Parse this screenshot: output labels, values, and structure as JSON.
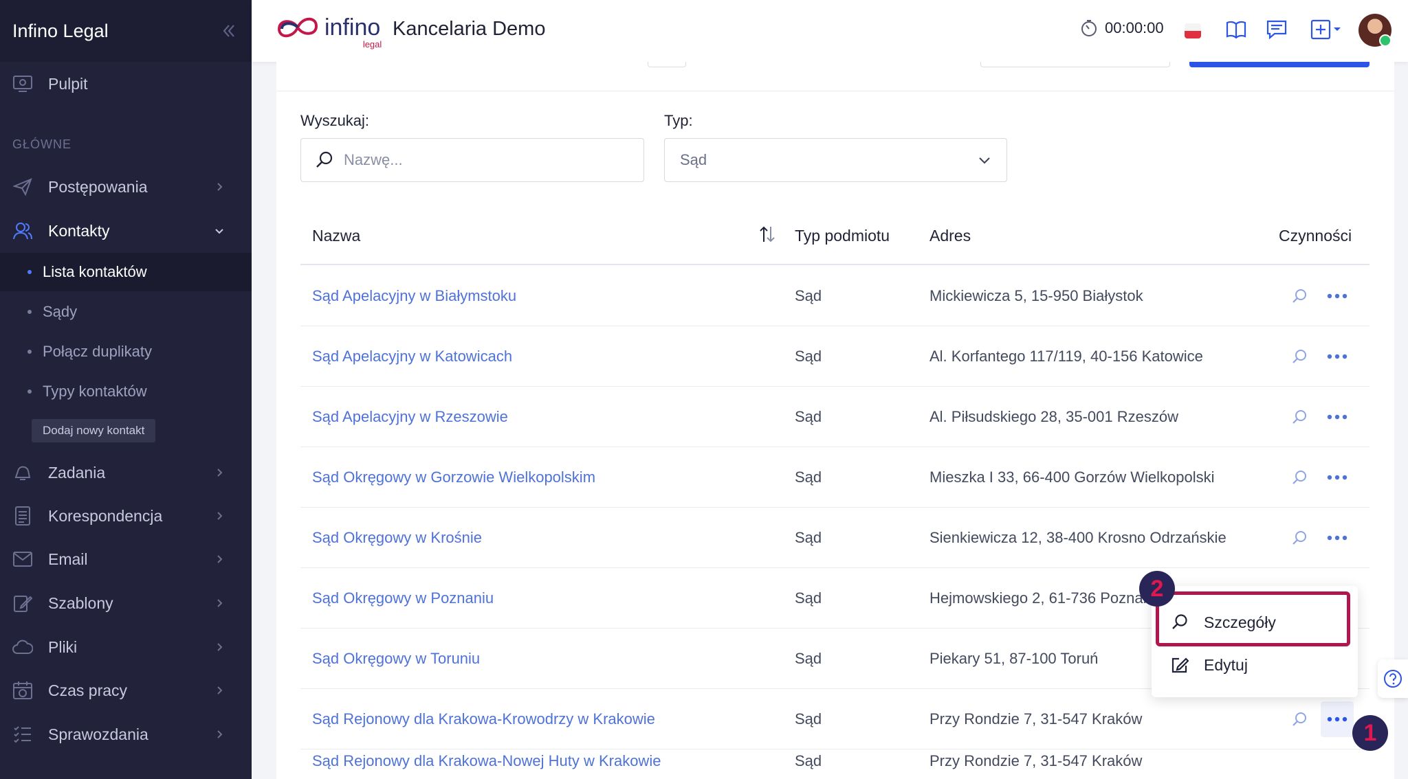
{
  "sidebar": {
    "title": "Infino Legal",
    "dashboard": "Pulpit",
    "section_label": "GŁÓWNE",
    "items": {
      "proceedings": "Postępowania",
      "contacts": "Kontakty",
      "tasks": "Zadania",
      "correspondence": "Korespondencja",
      "email": "Email",
      "templates": "Szablony",
      "files": "Pliki",
      "work_time": "Czas pracy",
      "reports": "Sprawozdania"
    },
    "contacts_sub": {
      "list": "Lista kontaktów",
      "courts": "Sądy",
      "merge": "Połącz duplikaty",
      "types": "Typy kontaktów",
      "add_new": "Dodaj nowy kontakt"
    }
  },
  "header": {
    "logo_word": "infino",
    "logo_sub": "legal",
    "firm_name": "Kancelaria Demo",
    "timer": "00:00:00"
  },
  "filters": {
    "search_label": "Wyszukaj:",
    "search_placeholder": "Nazwę...",
    "type_label": "Typ:",
    "type_value": "Sąd"
  },
  "table": {
    "columns": {
      "name": "Nazwa",
      "entity_type": "Typ podmiotu",
      "address": "Adres",
      "actions": "Czynności"
    },
    "rows": [
      {
        "name": "Sąd Apelacyjny w Białymstoku",
        "type": "Sąd",
        "address": "Mickiewicza 5, 15-950 Białystok"
      },
      {
        "name": "Sąd Apelacyjny w Katowicach",
        "type": "Sąd",
        "address": "Al. Korfantego 117/119, 40-156 Katowice"
      },
      {
        "name": "Sąd Apelacyjny w Rzeszowie",
        "type": "Sąd",
        "address": "Al. Piłsudskiego 28, 35-001 Rzeszów"
      },
      {
        "name": "Sąd Okręgowy w Gorzowie Wielkopolskim",
        "type": "Sąd",
        "address": "Mieszka I 33, 66-400 Gorzów Wielkopolski"
      },
      {
        "name": "Sąd Okręgowy w Krośnie",
        "type": "Sąd",
        "address": "Sienkiewicza 12, 38-400 Krosno Odrzańskie"
      },
      {
        "name": "Sąd Okręgowy w Poznaniu",
        "type": "Sąd",
        "address": "Hejmowskiego 2, 61-736 Poznań"
      },
      {
        "name": "Sąd Okręgowy w Toruniu",
        "type": "Sąd",
        "address": "Piekary 51, 87-100 Toruń"
      },
      {
        "name": "Sąd Rejonowy dla Krakowa-Krowodrzy w Krakowie",
        "type": "Sąd",
        "address": "Przy Rondzie 7, 31-547 Kraków"
      },
      {
        "name": "Sąd Rejonowy dla Krakowa-Nowej Huty w Krakowie",
        "type": "Sąd",
        "address": "Przy Rondzie 7, 31-547 Kraków"
      }
    ]
  },
  "action_menu": {
    "details": "Szczegóły",
    "edit": "Edytuj"
  },
  "steps": {
    "one": "1",
    "two": "2"
  },
  "colors": {
    "sidebar_bg": "#22223a",
    "link": "#4f72d6",
    "highlight": "#b0174e",
    "primary": "#2c54e6"
  }
}
